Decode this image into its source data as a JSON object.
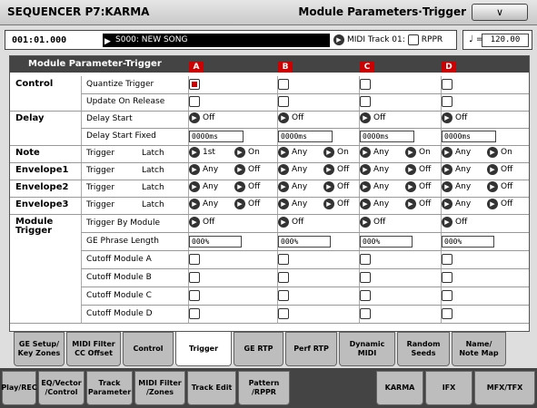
{
  "header": {
    "title": "SEQUENCER P7:KARMA",
    "page_title": "Module Parameters·Trigger",
    "menu_icon": "∨"
  },
  "songbar": {
    "location": "001:01.000",
    "song": "S000: NEW SONG",
    "midi_track": "MIDI Track 01:",
    "rppr": "RPPR"
  },
  "tempo": {
    "symbol": "♩ =",
    "value": "120.00"
  },
  "panel": {
    "title": "Module Parameter-Trigger",
    "slots": [
      "A",
      "B",
      "C",
      "D"
    ]
  },
  "sections": {
    "control": "Control",
    "delay": "Delay",
    "note": "Note",
    "env1": "Envelope1",
    "env2": "Envelope2",
    "env3": "Envelope3",
    "module": "Module Trigger"
  },
  "labels": {
    "quantize": "Quantize Trigger",
    "update": "Update On Release",
    "delay_start": "Delay Start",
    "delay_fixed": "Delay Start Fixed",
    "trigger": "Trigger",
    "latch": "Latch",
    "trig_by_module": "Trigger By Module",
    "ge_phrase": "GE Phrase Length",
    "cut_a": "Cutoff Module A",
    "cut_b": "Cutoff Module B",
    "cut_c": "Cutoff Module C",
    "cut_d": "Cutoff Module D"
  },
  "values": {
    "off": "Off",
    "on": "On",
    "any": "Any",
    "first": "1st",
    "ms": "0000ms",
    "pct": "000%"
  },
  "tabs_upper": [
    "GE Setup/\nKey Zones",
    "MIDI Filter\nCC Offset",
    "Control",
    "Trigger",
    "GE RTP",
    "Perf RTP",
    "Dynamic\nMIDI",
    "Random\nSeeds",
    "Name/\nNote Map"
  ],
  "tabs_lower": [
    "Play/REC",
    "EQ/Vector\n/Control",
    "Track\nParameter",
    "MIDI Filter\n/Zones",
    "Track Edit",
    "Pattern\n/RPPR",
    "",
    "KARMA",
    "IFX",
    "MFX/TFX"
  ],
  "colors": {
    "accent": "#cc0000",
    "dark": "#444444"
  }
}
